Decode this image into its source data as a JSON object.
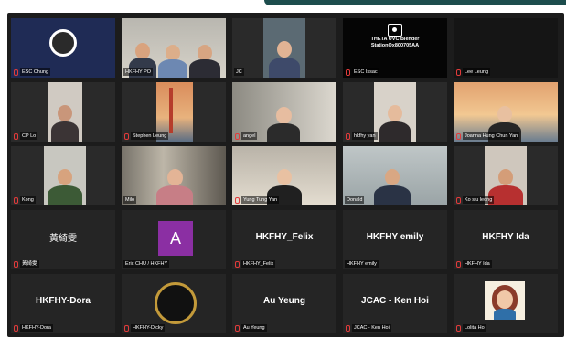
{
  "participants": [
    {
      "name": "ESC Chung"
    },
    {
      "name": "HKFHY PO"
    },
    {
      "name": "JC"
    },
    {
      "name": "ESC Issac"
    },
    {
      "name": "Lee Leung"
    },
    {
      "name": "CP Lo"
    },
    {
      "name": "Stephen Leung"
    },
    {
      "name": "angel"
    },
    {
      "name": "hkfhy yan"
    },
    {
      "name": "Joanna Hung Chun Yan"
    },
    {
      "name": "Kong"
    },
    {
      "name": "Milo"
    },
    {
      "name": "Yung Tung Yan"
    },
    {
      "name": "Donald"
    },
    {
      "name": "Ko siu leong"
    },
    {
      "name": "黃綺雯",
      "display": "黃綺雯"
    },
    {
      "name": "Eric CHU / HKFHY",
      "display": "A"
    },
    {
      "name": "HKFHY_Felix",
      "display": "HKFHY_Felix"
    },
    {
      "name": "HKFHY emily",
      "display": "HKFHY emily"
    },
    {
      "name": "HKFHY Ida",
      "display": "HKFHY Ida"
    },
    {
      "name": "HKFHY-Dora",
      "display": "HKFHY-Dora"
    },
    {
      "name": "HKFHY-Dicky"
    },
    {
      "name": "Au Yeung",
      "display": "Au Yeung"
    },
    {
      "name": "JCAC - Ken Hoi",
      "display": "JCAC - Ken Hoi"
    },
    {
      "name": "Lolita Ho"
    }
  ],
  "theta_text": {
    "line1": "THETA UVC Blender",
    "line2": "StationOx800705AA"
  },
  "colors": {
    "active_speaker": "#c8e33c",
    "muted": "#e23b3b",
    "tile_bg": "#252525"
  }
}
